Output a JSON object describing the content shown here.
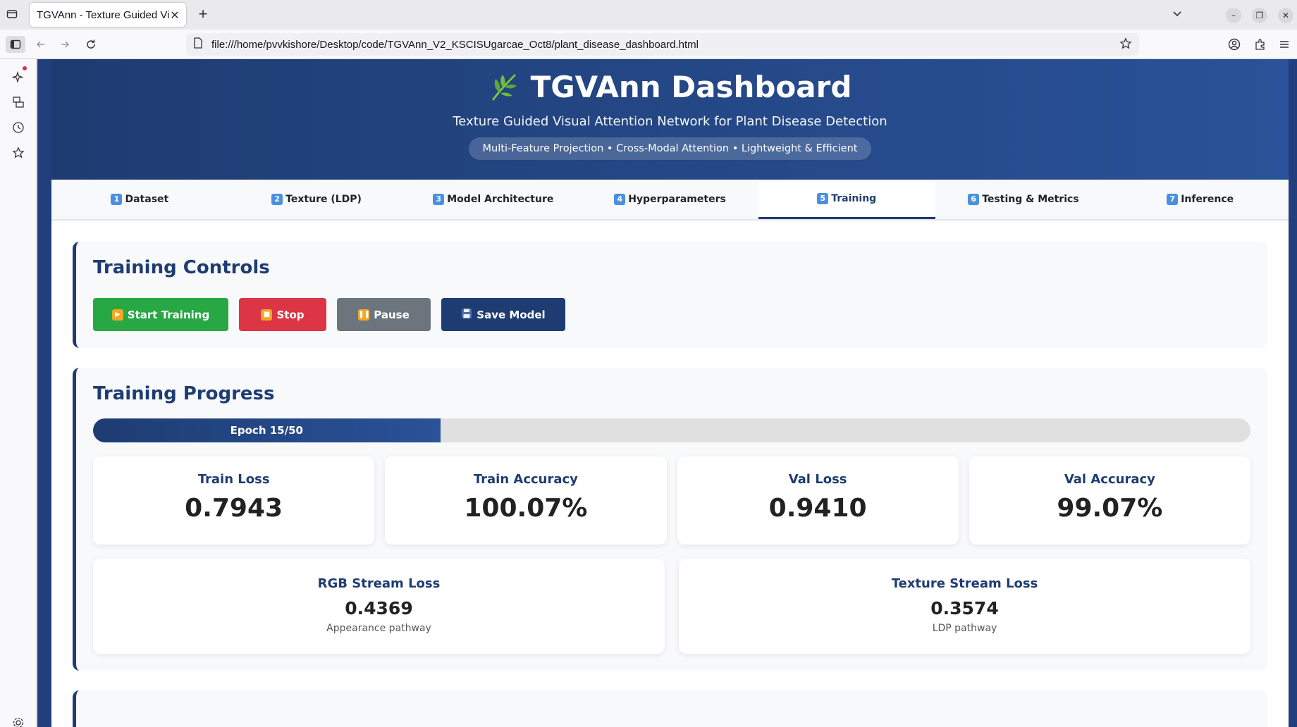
{
  "browser": {
    "tab_title": "TGVAnn - Texture Guided Vis",
    "url": "file:///home/pvvkishore/Desktop/code/TGVAnn_V2_KSCISUgarcae_Oct8/plant_disease_dashboard.html"
  },
  "header": {
    "title": "TGVAnn Dashboard",
    "subtitle": "Texture Guided Visual Attention Network for Plant Disease Detection",
    "tagline": "Multi-Feature Projection • Cross-Modal Attention • Lightweight & Efficient"
  },
  "tabs": [
    {
      "num": "1",
      "label": "Dataset"
    },
    {
      "num": "2",
      "label": "Texture (LDP)"
    },
    {
      "num": "3",
      "label": "Model Architecture"
    },
    {
      "num": "4",
      "label": "Hyperparameters"
    },
    {
      "num": "5",
      "label": "Training",
      "active": true
    },
    {
      "num": "6",
      "label": "Testing & Metrics"
    },
    {
      "num": "7",
      "label": "Inference"
    }
  ],
  "controls": {
    "title": "Training Controls",
    "start_label": "Start Training",
    "stop_label": "Stop",
    "pause_label": "Pause",
    "save_label": "Save Model",
    "colors": {
      "start": "#28a745",
      "stop": "#dc3545",
      "pause": "#6c757d",
      "save": "#1e3c72"
    }
  },
  "progress": {
    "title": "Training Progress",
    "label": "Epoch 15/50",
    "fraction": 0.3,
    "metrics": [
      {
        "label": "Train Loss",
        "value": "0.7943"
      },
      {
        "label": "Train Accuracy",
        "value": "100.07%"
      },
      {
        "label": "Val Loss",
        "value": "0.9410"
      },
      {
        "label": "Val Accuracy",
        "value": "99.07%"
      }
    ],
    "streams": [
      {
        "label": "RGB Stream Loss",
        "value": "0.4369",
        "sub": "Appearance pathway"
      },
      {
        "label": "Texture Stream Loss",
        "value": "0.3574",
        "sub": "LDP pathway"
      }
    ]
  },
  "icons": {
    "accent": "#1e3c72",
    "badge": "#4a8fe0"
  }
}
